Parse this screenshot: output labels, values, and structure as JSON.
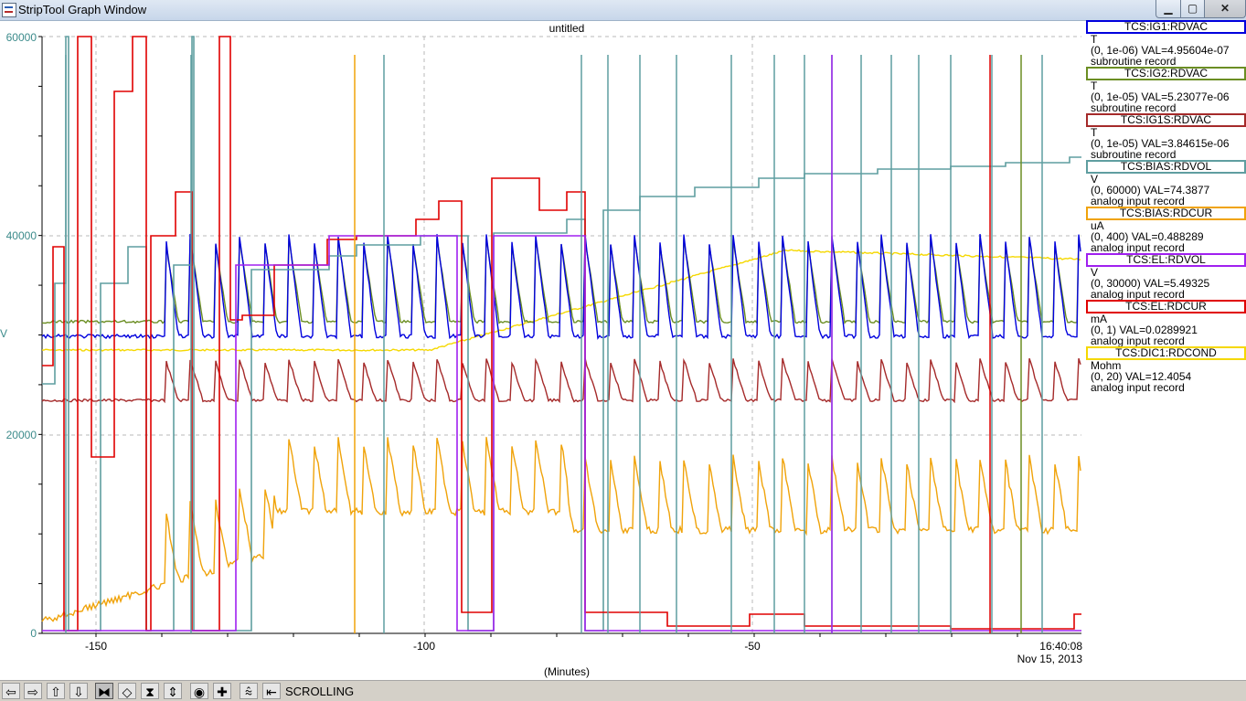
{
  "window": {
    "title": "StripTool Graph Window",
    "minimize_glyph": "▁",
    "maximize_glyph": "▢",
    "close_glyph": "✕"
  },
  "plot": {
    "title": "untitled",
    "y_unit": "V",
    "x_label": "(Minutes)",
    "timestamp_time": "16:40:08",
    "timestamp_date": "Nov 15, 2013",
    "y_tick_labels": [
      "60000",
      "40000",
      "20000",
      "0"
    ],
    "x_tick_labels": [
      "-150",
      "-100",
      "-50"
    ]
  },
  "legend": [
    {
      "name": "TCS:IG1:RDVAC",
      "color": "#0000dd",
      "unit": "T",
      "range_val": "(0, 1e-06) VAL=4.95604e-07",
      "type": "subroutine record"
    },
    {
      "name": "TCS:IG2:RDVAC",
      "color": "#6b8e23",
      "unit": "T",
      "range_val": "(0, 1e-05) VAL=5.23077e-06",
      "type": "subroutine record"
    },
    {
      "name": "TCS:IG1S:RDVAC",
      "color": "#a52a2a",
      "unit": "T",
      "range_val": "(0, 1e-05) VAL=3.84615e-06",
      "type": "subroutine record"
    },
    {
      "name": "TCS:BIAS:RDVOL",
      "color": "#5f9ea0",
      "unit": "V",
      "range_val": "(0, 60000) VAL=74.3877",
      "type": "analog input record"
    },
    {
      "name": "TCS:BIAS:RDCUR",
      "color": "#f0a30a",
      "unit": "uA",
      "range_val": "(0, 400) VAL=0.488289",
      "type": "analog input record"
    },
    {
      "name": "TCS:EL:RDVOL",
      "color": "#a020f0",
      "unit": "V",
      "range_val": "(0, 30000) VAL=5.49325",
      "type": "analog input record"
    },
    {
      "name": "TCS:EL:RDCUR",
      "color": "#e00000",
      "unit": "mA",
      "range_val": "(0, 1) VAL=0.0289921",
      "type": "analog input record"
    },
    {
      "name": "TCS:DIC1:RDCOND",
      "color": "#f5d800",
      "unit": "Mohm",
      "range_val": "(0, 20) VAL=12.4054",
      "type": "analog input record"
    }
  ],
  "toolbar": {
    "buttons": [
      {
        "name": "pan-left-button",
        "glyph": "⇦"
      },
      {
        "name": "pan-right-button",
        "glyph": "⇨"
      },
      {
        "name": "pan-up-button",
        "glyph": "⇧"
      },
      {
        "name": "pan-down-button",
        "glyph": "⇩"
      },
      {
        "name": "zoom-in-x-button",
        "glyph": "⧓"
      },
      {
        "name": "zoom-out-x-button",
        "glyph": "◇"
      },
      {
        "name": "zoom-in-y-button",
        "glyph": "⧗"
      },
      {
        "name": "zoom-out-y-button",
        "glyph": "⇕"
      },
      {
        "name": "refresh-button",
        "glyph": "◉"
      },
      {
        "name": "add-button",
        "glyph": "✚"
      },
      {
        "name": "autoscale-button",
        "glyph": "⩯"
      },
      {
        "name": "jump-to-now-button",
        "glyph": "⇤"
      }
    ],
    "mode_label": "SCROLLING"
  }
}
